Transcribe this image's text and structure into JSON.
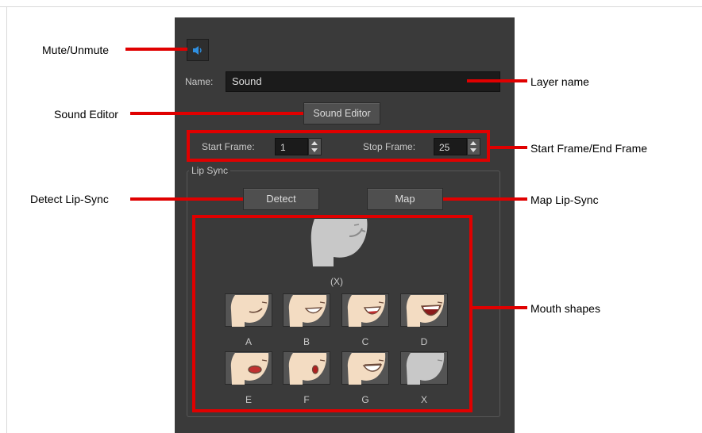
{
  "layer": {
    "name_label": "Name:",
    "name_value": "Sound",
    "sound_editor_label": "Sound Editor"
  },
  "frames": {
    "start_label": "Start Frame:",
    "start_value": "1",
    "stop_label": "Stop Frame:",
    "stop_value": "25"
  },
  "lip_sync": {
    "group_title": "Lip Sync",
    "detect_label": "Detect",
    "map_label": "Map",
    "current_shape_label": "(X)",
    "mouths": [
      {
        "label": "A"
      },
      {
        "label": "B"
      },
      {
        "label": "C"
      },
      {
        "label": "D"
      },
      {
        "label": "E"
      },
      {
        "label": "F"
      },
      {
        "label": "G"
      },
      {
        "label": "X"
      }
    ]
  },
  "annotations": {
    "mute": "Mute/Unmute",
    "layer_name": "Layer name",
    "sound_editor": "Sound Editor",
    "start_end_frame": "Start Frame/End Frame",
    "detect": "Detect Lip-Sync",
    "map": "Map Lip-Sync",
    "mouth_shapes": "Mouth shapes"
  },
  "colors": {
    "panel_bg": "#3a3a3a",
    "annotation_red": "#e00000",
    "speaker_blue": "#2f8fe0",
    "skin": "#f3dcc2"
  },
  "icons": {
    "mute": "speaker-icon"
  }
}
